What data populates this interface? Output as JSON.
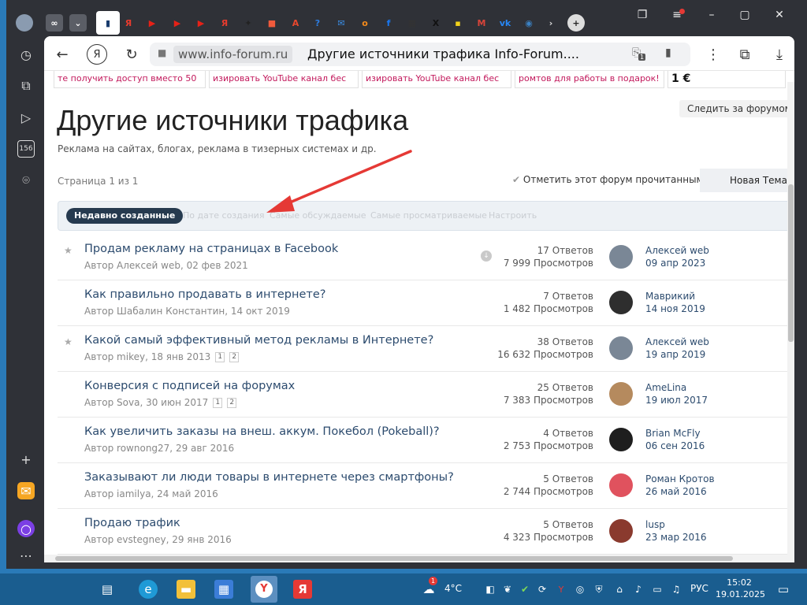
{
  "browser": {
    "domain": "www.info-forum.ru",
    "tab_title": "Другие источники трафика Info-Forum....",
    "tabs": [
      {
        "name": "tab-infinity",
        "glyph": "∞",
        "color": "#555"
      },
      {
        "name": "tab-collapse",
        "glyph": "⌄",
        "color": "#444"
      },
      {
        "name": "tab-active-forum",
        "glyph": "▮",
        "color": "#ffffff"
      },
      {
        "name": "tab-yandex-1",
        "glyph": "Я",
        "color": "#e63b2e"
      },
      {
        "name": "tab-youtube-1",
        "glyph": "▶",
        "color": "#e62117"
      },
      {
        "name": "tab-youtube-2",
        "glyph": "▶",
        "color": "#e62117"
      },
      {
        "name": "tab-youtube-3",
        "glyph": "▶",
        "color": "#e62117"
      },
      {
        "name": "tab-yandex-2",
        "glyph": "Я",
        "color": "#e63b2e"
      },
      {
        "name": "tab-star",
        "glyph": "✦",
        "color": "#222"
      },
      {
        "name": "tab-doc",
        "glyph": "■",
        "color": "#f05a3c"
      },
      {
        "name": "tab-translate",
        "glyph": "A",
        "color": "#e8482e"
      },
      {
        "name": "tab-help",
        "glyph": "?",
        "color": "#2d7de1"
      },
      {
        "name": "tab-mail",
        "glyph": "✉",
        "color": "#3a8ee6"
      },
      {
        "name": "tab-ok",
        "glyph": "о",
        "color": "#f28a1c"
      },
      {
        "name": "tab-facebook",
        "glyph": "f",
        "color": "#1877f2"
      },
      {
        "name": "tab-grid",
        "glyph": "▦",
        "color": "#333"
      },
      {
        "name": "tab-x",
        "glyph": "X",
        "color": "#111"
      },
      {
        "name": "tab-yellow",
        "glyph": "▪",
        "color": "#f2d21a"
      },
      {
        "name": "tab-gmail",
        "glyph": "M",
        "color": "#d8443a"
      },
      {
        "name": "tab-vk",
        "glyph": "vk",
        "color": "#2787f5"
      },
      {
        "name": "tab-circle",
        "glyph": "◉",
        "color": "#3b82c4"
      },
      {
        "name": "tab-green",
        "glyph": "▮",
        "color": "#4caf50"
      }
    ],
    "download_badge": "1"
  },
  "ads": [
    "те получить доступ вместо 50",
    "изировать YouTube канал бес",
    "изировать YouTube канал бес",
    "ромтов для работы в подарок!",
    "1 €"
  ],
  "forum": {
    "title": "Другие источники трафика",
    "description": "Реклама на сайтах, блогах, реклама в тизерных системах и др.",
    "follow_label": "Следить за форумом",
    "page_info": "Страница 1 из 1",
    "mark_read_label": "Отметить этот форум прочитанным",
    "new_topic_label": "Новая Тема",
    "filters": {
      "active": "Недавно созданные",
      "others": [
        "По дате создания",
        "Самые обсуждаемые",
        "Самые просматриваемые",
        "Настроить"
      ]
    }
  },
  "topics": [
    {
      "starred": true,
      "title": "Продам рекламу на страницах в Facebook",
      "meta": "Автор Алексей web, 02 фев 2021",
      "pages": [],
      "download": true,
      "replies": "17 Ответов",
      "views": "7 999 Просмотров",
      "last_user": "Алексей web",
      "last_date": "09 апр 2023",
      "avatar_color": "#7a8796"
    },
    {
      "starred": false,
      "title": "Как правильно продавать в интернете?",
      "meta": "Автор Шабалин Константин, 14 окт 2019",
      "pages": [],
      "download": false,
      "replies": "7 Ответов",
      "views": "1 482 Просмотров",
      "last_user": "Маврикий",
      "last_date": "14 ноя 2019",
      "avatar_color": "#2e2e2e"
    },
    {
      "starred": true,
      "title": "Какой самый эффективный метод рекламы в Интернете?",
      "meta": "Автор mikey, 18 янв 2013",
      "pages": [
        "1",
        "2"
      ],
      "download": false,
      "replies": "38 Ответов",
      "views": "16 632 Просмотров",
      "last_user": "Алексей web",
      "last_date": "19 апр 2019",
      "avatar_color": "#7a8796"
    },
    {
      "starred": false,
      "title": "Конверсия с подписей на форумах",
      "meta": "Автор Sova, 30 июн 2017",
      "pages": [
        "1",
        "2"
      ],
      "download": false,
      "replies": "25 Ответов",
      "views": "7 383 Просмотров",
      "last_user": "AmeLina",
      "last_date": "19 июл 2017",
      "avatar_color": "#b58a5e"
    },
    {
      "starred": false,
      "title": "Как увеличить заказы на внеш. аккум. Покебол (Pokeball)?",
      "meta": "Автор rownong27, 29 авг 2016",
      "pages": [],
      "download": false,
      "replies": "4 Ответов",
      "views": "2 753 Просмотров",
      "last_user": "Brian McFly",
      "last_date": "06 сен 2016",
      "avatar_color": "#1e1e1e"
    },
    {
      "starred": false,
      "title": "Заказывают ли люди товары в интернете через смартфоны?",
      "meta": "Автор iamilya, 24 май 2016",
      "pages": [],
      "download": false,
      "replies": "5 Ответов",
      "views": "2 744 Просмотров",
      "last_user": "Роман Кротов",
      "last_date": "26 май 2016",
      "avatar_color": "#e0525e"
    },
    {
      "starred": false,
      "title": "Продаю трафик",
      "meta": "Автор evstegney, 29 янв 2016",
      "pages": [],
      "download": false,
      "replies": "5 Ответов",
      "views": "4 323 Просмотров",
      "last_user": "lusp",
      "last_date": "23 мар 2016",
      "avatar_color": "#8a3a2e"
    }
  ],
  "taskbar": {
    "temperature": "4°C",
    "weather_badge": "1",
    "language": "РУС",
    "time": "15:02",
    "date": "19.01.2025"
  }
}
